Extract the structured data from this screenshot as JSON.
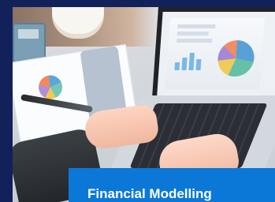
{
  "caption": "Financial Modelling"
}
